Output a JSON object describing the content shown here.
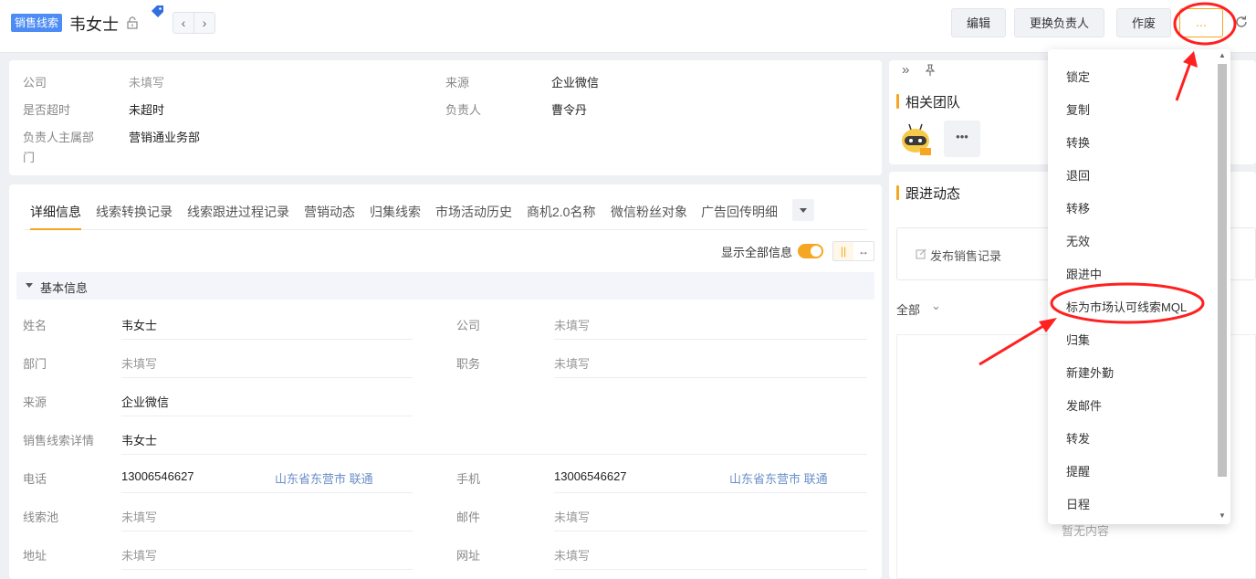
{
  "header": {
    "tag": "销售线索",
    "title": "韦女士",
    "buttons": {
      "edit": "编辑",
      "change_owner": "更换负责人",
      "void": "作废",
      "more": "..."
    }
  },
  "summary": {
    "company_label": "公司",
    "company_value": "未填写",
    "source_label": "来源",
    "source_value": "企业微信",
    "overdue_label": "是否超时",
    "overdue_value": "未超时",
    "owner_label": "负责人",
    "owner_value": "曹令丹",
    "dept_label_1": "负责人主属部",
    "dept_label_2": "门",
    "dept_value": "营销通业务部"
  },
  "tabs": [
    "详细信息",
    "线索转换记录",
    "线索跟进过程记录",
    "营销动态",
    "归集线索",
    "市场活动历史",
    "商机2.0名称",
    "微信粉丝对象",
    "广告回传明细"
  ],
  "toggle": {
    "label": "显示全部信息"
  },
  "section": {
    "title": "基本信息"
  },
  "fields": {
    "name_label": "姓名",
    "name_value": "韦女士",
    "company_label": "公司",
    "company_value": "未填写",
    "dept_label": "部门",
    "dept_value": "未填写",
    "position_label": "职务",
    "position_value": "未填写",
    "source_label": "来源",
    "source_value": "企业微信",
    "detail_label": "销售线索详情",
    "detail_value": "韦女士",
    "phone_label": "电话",
    "phone_value": "13006546627",
    "phone_loc": "山东省东营市 联通",
    "mobile_label": "手机",
    "mobile_value": "13006546627",
    "mobile_loc": "山东省东营市 联通",
    "pool_label": "线索池",
    "pool_value": "未填写",
    "email_label": "邮件",
    "email_value": "未填写",
    "address_label": "地址",
    "address_value": "未填写",
    "website_label": "网址",
    "website_value": "未填写"
  },
  "right": {
    "team_title": "相关团队",
    "follow_title": "跟进动态",
    "publish": "发布销售记录",
    "filter": "全部",
    "empty": "暂无内容"
  },
  "menu": [
    "锁定",
    "复制",
    "转换",
    "退回",
    "转移",
    "无效",
    "跟进中",
    "标为市场认可线索MQL",
    "归集",
    "新建外勤",
    "发邮件",
    "转发",
    "提醒",
    "日程"
  ],
  "colors": {
    "accent": "#f5a623",
    "tag": "#4d8cf5",
    "annotation": "#ff2020"
  }
}
